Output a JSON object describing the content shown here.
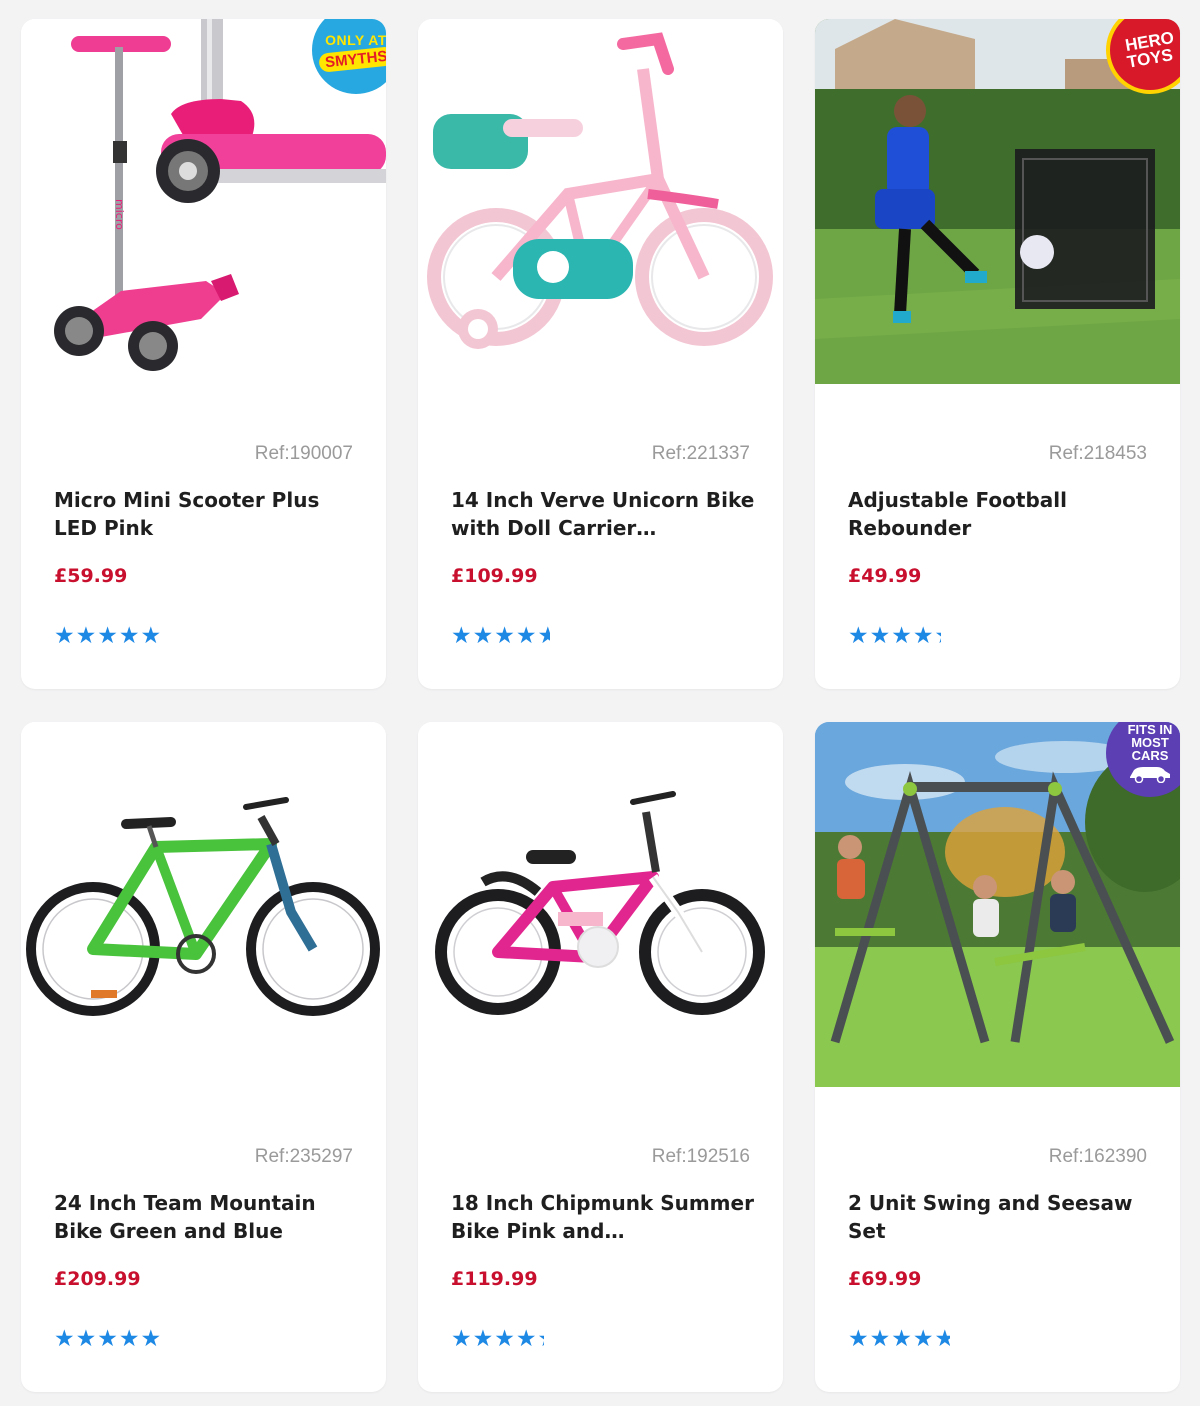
{
  "products": [
    {
      "ref": "Ref:190007",
      "title": "Micro Mini Scooter Plus LED Pink",
      "price": "£59.99",
      "rating": 5.0,
      "badge": {
        "type": "smyths",
        "line1": "ONLY AT",
        "line2": "SMYTHS"
      }
    },
    {
      "ref": "Ref:221337",
      "title": "14 Inch Verve Unicorn Bike with Doll Carrier…",
      "price": "£109.99",
      "rating": 4.6
    },
    {
      "ref": "Ref:218453",
      "title": "Adjustable Football Rebounder",
      "price": "£49.99",
      "rating": 4.3,
      "badge": {
        "type": "hero",
        "line1": "HERO",
        "line2": "TOYS"
      }
    },
    {
      "ref": "Ref:235297",
      "title": "24 Inch Team Mountain Bike Green and Blue",
      "price": "£209.99",
      "rating": 5.0
    },
    {
      "ref": "Ref:192516",
      "title": "18 Inch Chipmunk Summer Bike Pink and…",
      "price": "£119.99",
      "rating": 4.3
    },
    {
      "ref": "Ref:162390",
      "title": "2 Unit Swing and Seesaw Set",
      "price": "£69.99",
      "rating": 4.7,
      "badge": {
        "type": "fits",
        "line1": "FITS IN",
        "line2": "MOST",
        "line3": "CARS"
      }
    }
  ],
  "colors": {
    "price": "#c8102e",
    "star": "#1e88e5",
    "ref": "#9a9a9a",
    "title": "#1f1f1f"
  }
}
